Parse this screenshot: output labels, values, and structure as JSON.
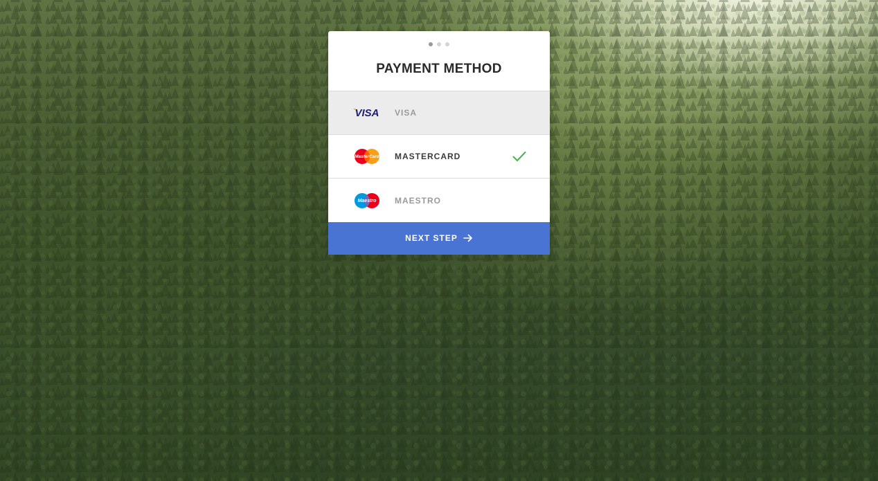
{
  "stepper": {
    "total_steps": 3,
    "current_step": 1
  },
  "card": {
    "title": "PAYMENT METHOD"
  },
  "options": [
    {
      "label": "VISA",
      "logo_text": "VISA",
      "icon": "visa-logo-icon",
      "state": "hovered"
    },
    {
      "label": "MASTERCARD",
      "logo_text": "MasterCard",
      "icon": "mastercard-logo-icon",
      "state": "selected"
    },
    {
      "label": "MAESTRO",
      "logo_text": "Maestro",
      "icon": "maestro-logo-icon",
      "state": "default"
    }
  ],
  "next_button": {
    "label": "NEXT STEP",
    "icon": "arrow-right-icon"
  },
  "colors": {
    "accent": "#4a74d4",
    "check": "#4caf50",
    "visa_blue": "#1a1f71",
    "visa_gold": "#f7b600",
    "mc_red": "#eb001b",
    "mc_orange": "#f79e1b",
    "maestro_blue": "#0099df"
  },
  "background": {
    "description_icon": "forest-landscape-background"
  }
}
